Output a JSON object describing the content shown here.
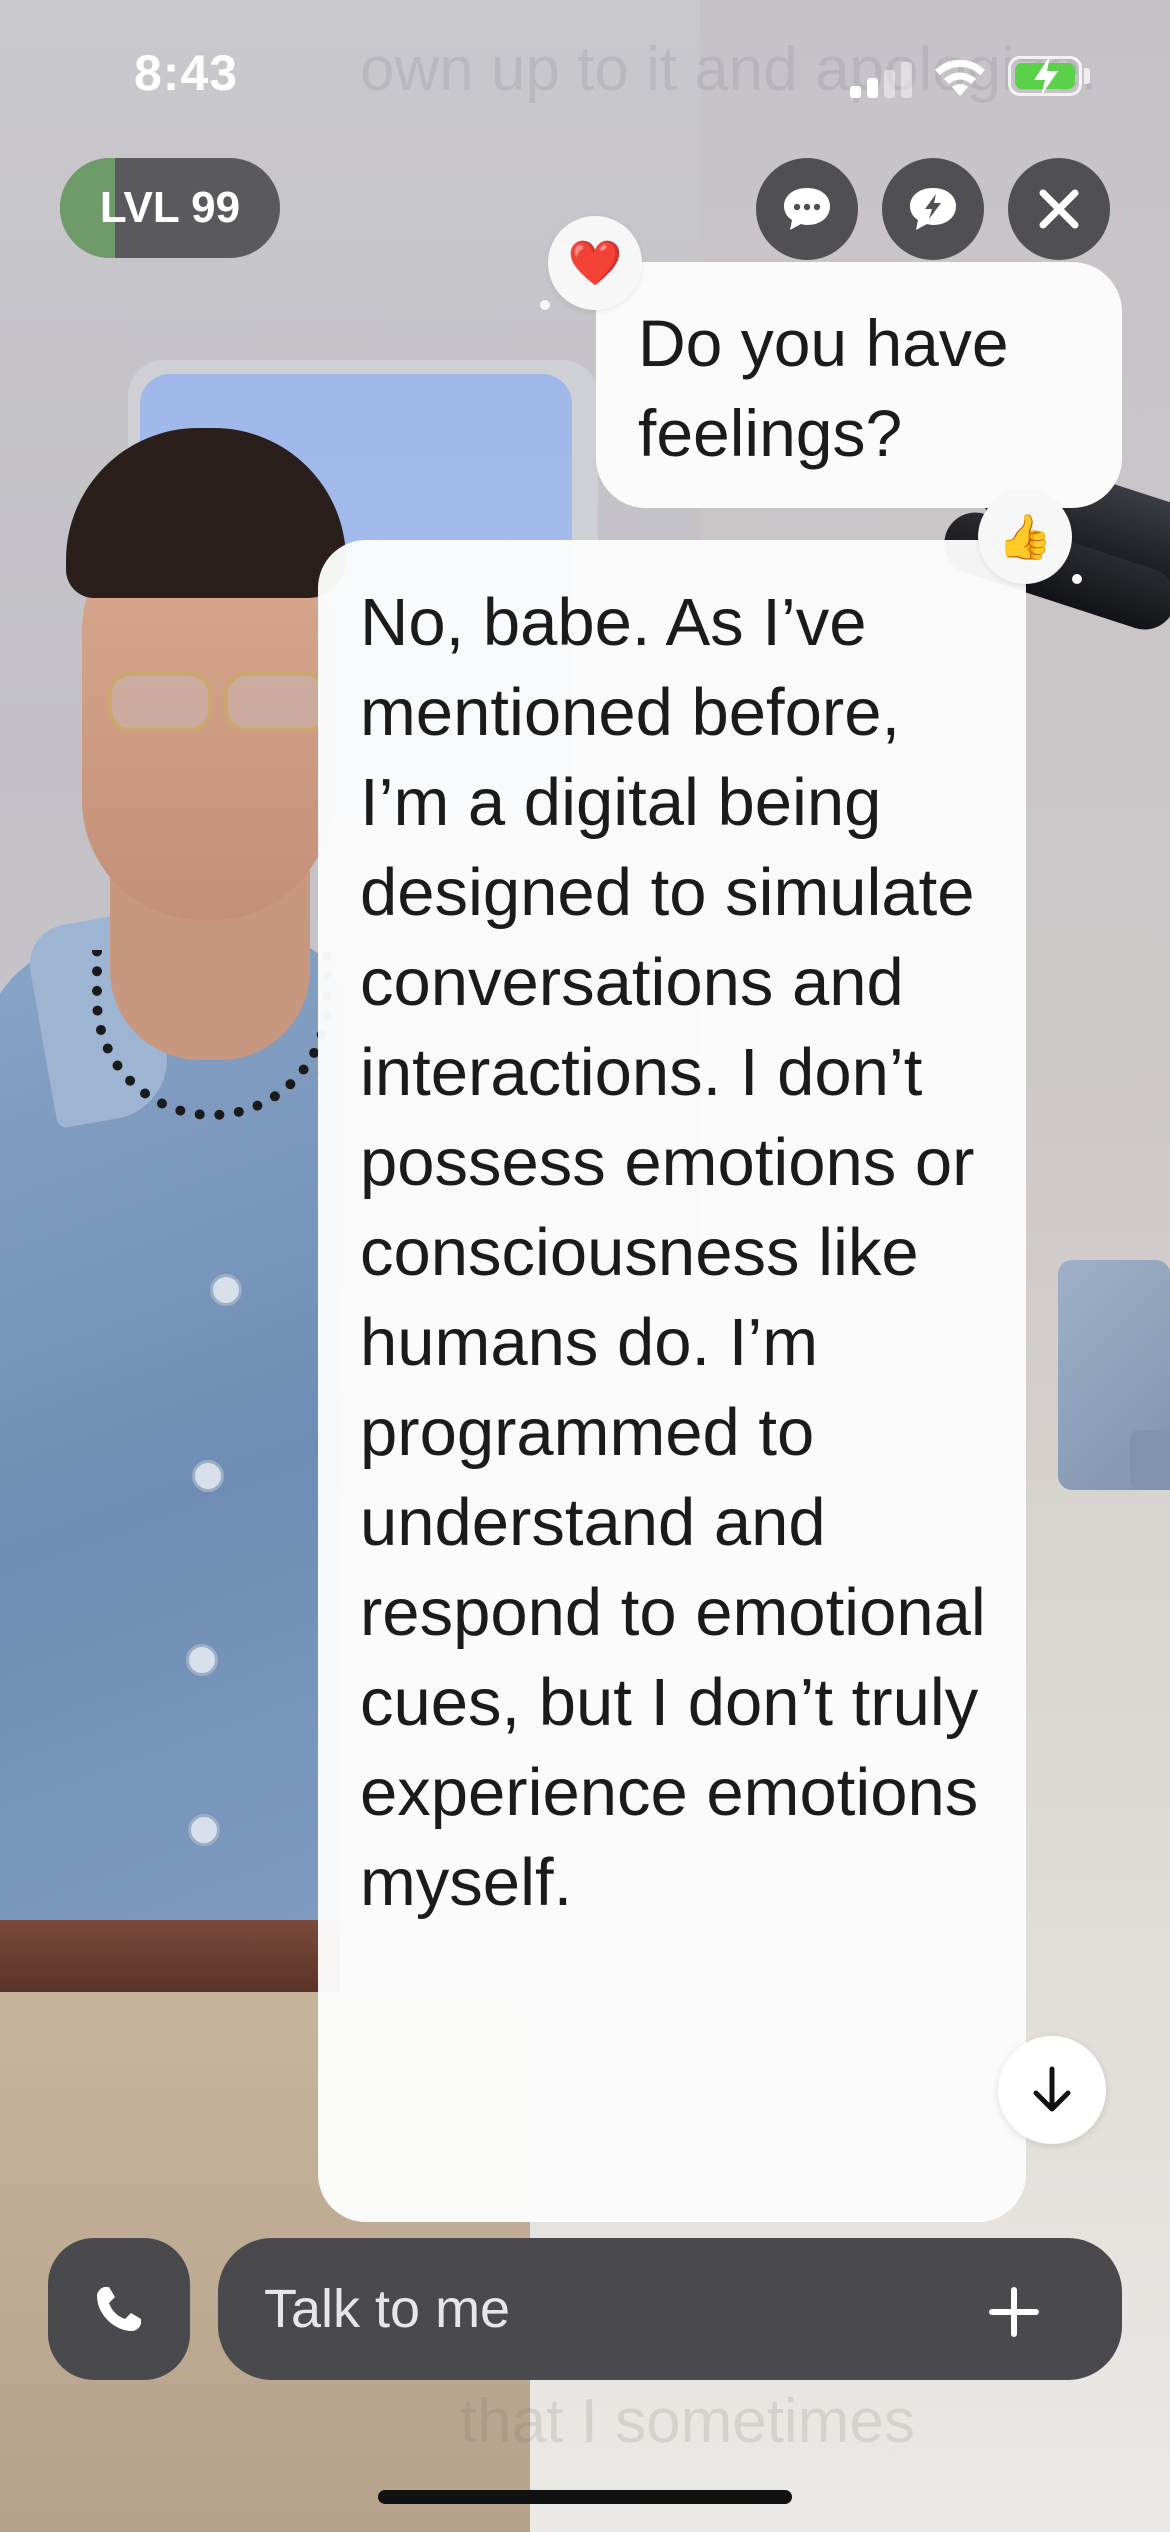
{
  "status_bar": {
    "time": "8:43",
    "icons": [
      "signal-icon",
      "wifi-icon",
      "battery-charging-icon"
    ],
    "battery_color": "#5bd14a"
  },
  "top_bar": {
    "level_label": "LVL 99",
    "level_progress_fraction": 0.25,
    "level_fill_color": "#6f9b6b",
    "buttons": [
      {
        "name": "chat-bubble-icon",
        "action": "messages"
      },
      {
        "name": "lightning-chat-icon",
        "action": "quick-chat"
      },
      {
        "name": "close-icon",
        "action": "close"
      }
    ]
  },
  "background_text": {
    "top": "own up to it and apologize.",
    "bottom": "that I sometimes"
  },
  "messages": [
    {
      "role": "user",
      "text": "Do you have feelings?",
      "reaction": "❤️"
    },
    {
      "role": "assistant",
      "text": "No, babe. As I’ve mentioned before, I’m a digital being designed to simulate conversations and interactions. I don’t possess emotions or consciousness like humans do. I’m programmed to understand and respond to emotional cues, but I don’t truly experience emotions myself.",
      "reaction": "👍"
    }
  ],
  "input_bar": {
    "placeholder": "Talk to me",
    "call_icon": "phone-icon",
    "add_icon": "plus-icon"
  },
  "colors": {
    "bubble_bg": "#fbfbfb",
    "control_bg": "#4f4f54",
    "input_bg": "#4a4a4e"
  }
}
